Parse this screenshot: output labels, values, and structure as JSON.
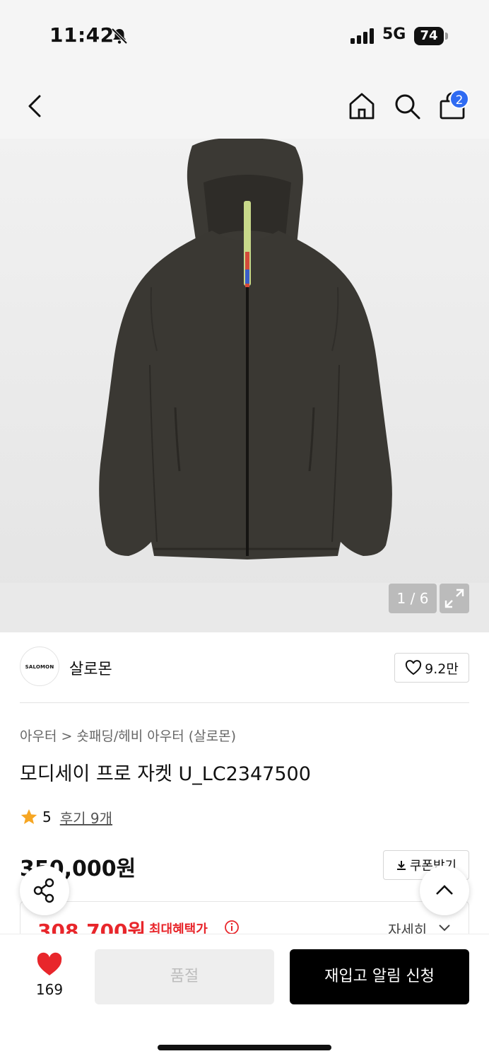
{
  "status_bar": {
    "time": "11:42",
    "network": "5G",
    "battery": "74"
  },
  "nav": {
    "cart_count": "2"
  },
  "gallery": {
    "counter": "1 / 6"
  },
  "brand": {
    "logo_text": "SALOMON",
    "name": "살로몬",
    "likes": "9.2만"
  },
  "product": {
    "breadcrumb": "아우터 > 숏패딩/헤비 아우터 (살로몬)",
    "title": "모디세이 프로 자켓 U_LC2347500",
    "rating": "5",
    "reviews": "후기 9개",
    "price": "350,000원",
    "coupon_label": "쿠폰받기",
    "benefit_price": "308,700원",
    "benefit_label": "최대혜택가",
    "detail_label": "자세히"
  },
  "bottom_bar": {
    "wish_count": "169",
    "soldout_label": "품절",
    "restock_label": "재입고 알림 신청"
  },
  "colors": {
    "accent_red": "#e8262b",
    "badge_blue": "#2f6bf2",
    "jacket": "#3a3833"
  }
}
